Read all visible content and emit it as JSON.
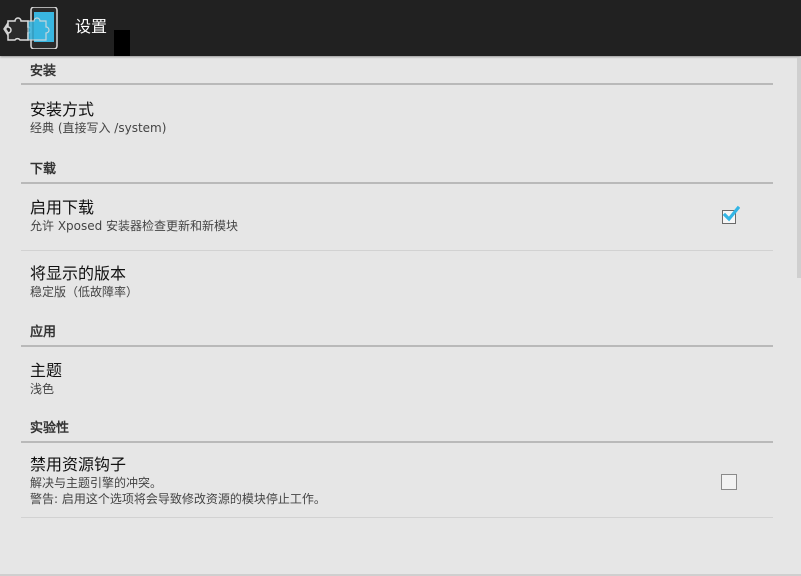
{
  "actionbar": {
    "back_glyph": "❮",
    "app_icon": "xposed-puzzle-phone-icon",
    "title": "设置"
  },
  "sections": {
    "install": {
      "header": "安装",
      "install_method": {
        "title": "安装方式",
        "summary": "经典 (直接写入 /system)"
      }
    },
    "download": {
      "header": "下载",
      "enable_download": {
        "title": "启用下载",
        "summary": "允许 Xposed 安装器检查更新和新模块",
        "checked": true
      },
      "version_shown": {
        "title": "将显示的版本",
        "summary": "稳定版（低故障率）"
      }
    },
    "app": {
      "header": "应用",
      "theme": {
        "title": "主题",
        "summary": "浅色"
      }
    },
    "experimental": {
      "header": "实验性",
      "disable_resources": {
        "title": "禁用资源钩子",
        "summary_line1": "解决与主题引擎的冲突。",
        "summary_line2": "警告: 启用这个选项将会导致修改资源的模块停止工作。",
        "checked": false
      }
    }
  },
  "colors": {
    "actionbar_bg": "#212121",
    "page_bg": "#e6e6e6",
    "accent": "#33b5e5"
  }
}
